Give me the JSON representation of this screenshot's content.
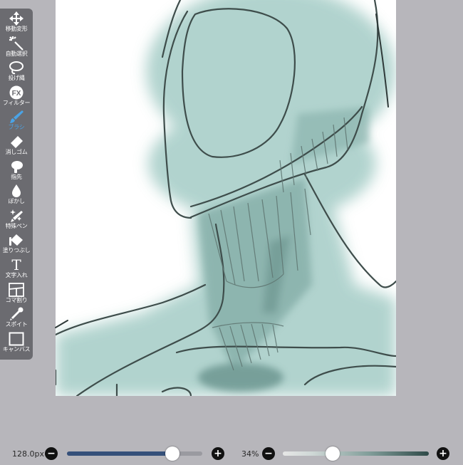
{
  "toolbar": {
    "tools": [
      {
        "label": "移動変形",
        "icon": "move-transform-icon"
      },
      {
        "label": "自動選択",
        "icon": "magic-wand-icon"
      },
      {
        "label": "投げ縄",
        "icon": "lasso-icon"
      },
      {
        "label": "フィルター",
        "icon": "fx-icon"
      },
      {
        "label": "ブラシ",
        "icon": "brush-icon",
        "active": true
      },
      {
        "label": "消しゴム",
        "icon": "eraser-icon"
      },
      {
        "label": "指先",
        "icon": "finger-smudge-icon"
      },
      {
        "label": "ぼかし",
        "icon": "blur-drop-icon"
      },
      {
        "label": "特殊ペン",
        "icon": "special-pen-icon"
      },
      {
        "label": "塗りつぶし",
        "icon": "fill-bucket-icon"
      },
      {
        "label": "文字入れ",
        "icon": "text-icon"
      },
      {
        "label": "コマ割り",
        "icon": "frame-divide-icon"
      },
      {
        "label": "スポイト",
        "icon": "eyedropper-icon"
      },
      {
        "label": "キャンバス",
        "icon": "canvas-icon"
      }
    ],
    "fx_text": "FX",
    "text_glyph": "T"
  },
  "bottom_bar": {
    "brush_size": "128.0px",
    "brush_size_fraction": 0.78,
    "opacity": "34%",
    "opacity_fraction": 0.34,
    "minus": "−",
    "plus": "+"
  },
  "colors": {
    "accent": "#4aa3e6",
    "toolbar_bg": "#6b6b70",
    "paint": "#a9cfc9",
    "line": "#3e4d4b"
  }
}
